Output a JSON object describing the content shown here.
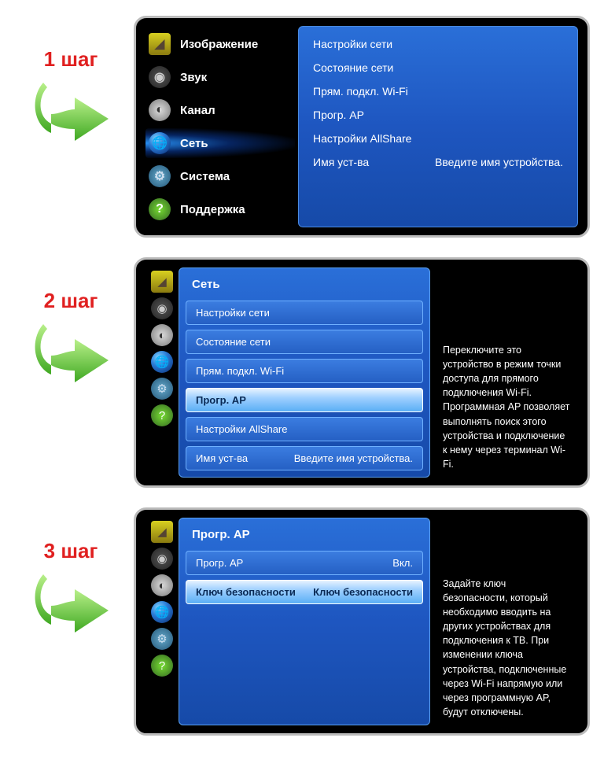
{
  "steps": {
    "s1": {
      "label": "1 шаг"
    },
    "s2": {
      "label": "2 шаг"
    },
    "s3": {
      "label": "3 шаг"
    }
  },
  "sidebar": {
    "picture": "Изображение",
    "sound": "Звук",
    "channel": "Канал",
    "network": "Сеть",
    "system": "Система",
    "support": "Поддержка"
  },
  "panel1": {
    "net_settings": "Настройки сети",
    "net_status": "Состояние сети",
    "wifi_direct": "Прям. подкл. Wi-Fi",
    "soft_ap": "Прогр. AP",
    "allshare": "Настройки AllShare",
    "device_name_label": "Имя уст-ва",
    "device_name_value": "Введите имя устройства."
  },
  "panel2": {
    "title": "Сеть",
    "net_settings": "Настройки сети",
    "net_status": "Состояние сети",
    "wifi_direct": "Прям. подкл. Wi-Fi",
    "soft_ap": "Прогр. AP",
    "allshare": "Настройки AllShare",
    "device_name_label": "Имя уст-ва",
    "device_name_value": "Введите имя устройства.",
    "info": "Переключите это устройство в режим точки доступа для прямого подключения Wi-Fi. Программная AP позволяет выполнять поиск этого устройства и подключение к нему через терминал Wi-Fi."
  },
  "panel3": {
    "title": "Прогр. AP",
    "row1_label": "Прогр. AP",
    "row1_value": "Вкл.",
    "row2_label": "Ключ безопасности",
    "row2_value": "Ключ безопасности",
    "info": "Задайте ключ безопасности, который необходимо вводить на других устройствах для подключения к ТВ. При изменении ключа устройства, подключенные через Wi-Fi напрямую или через программную AP, будут отключены."
  }
}
